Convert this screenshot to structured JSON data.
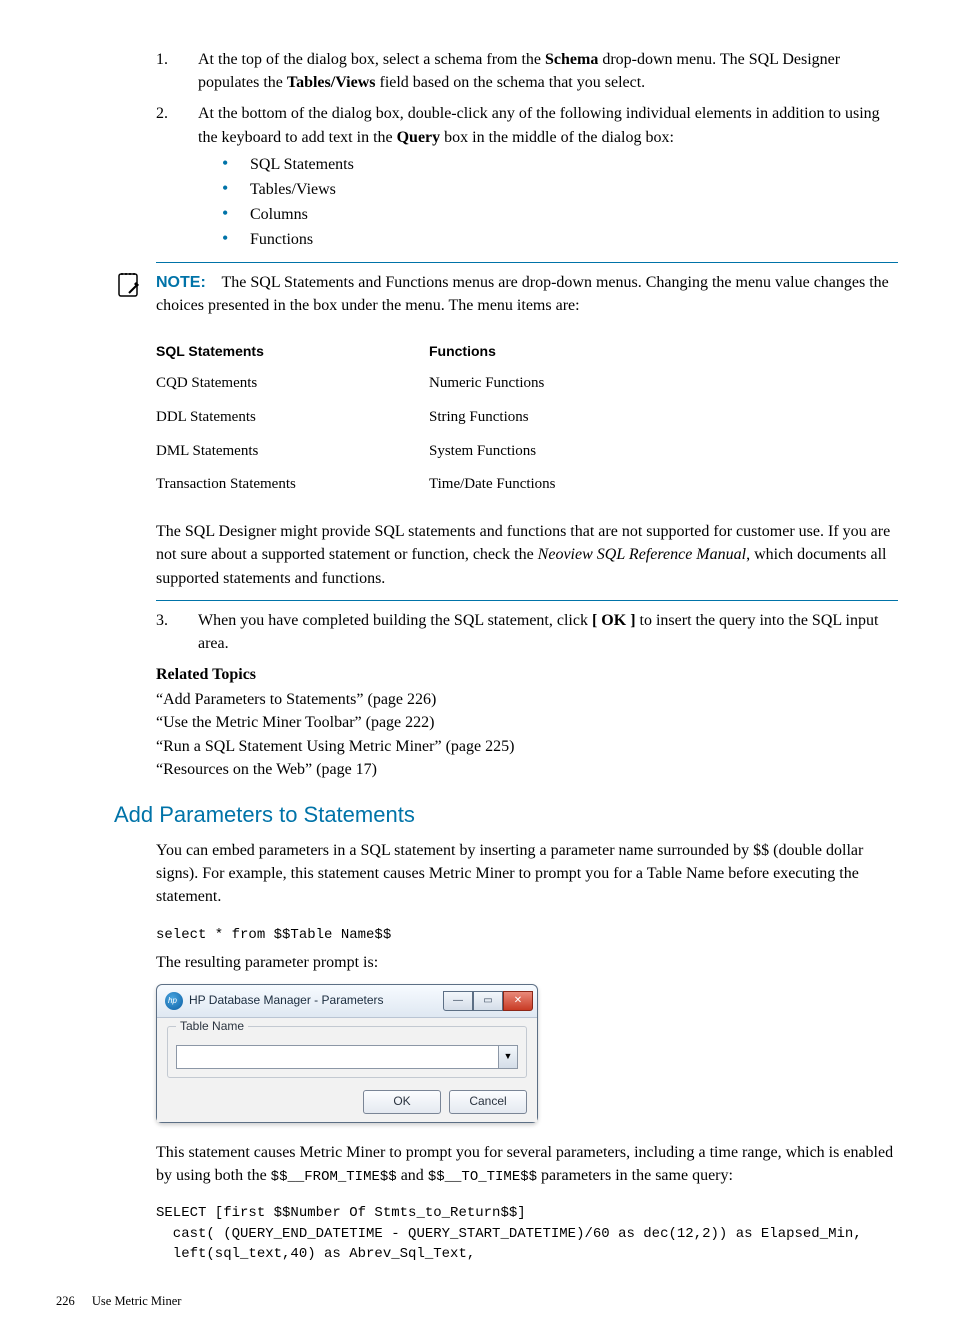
{
  "steps": {
    "s1": {
      "text_a": "At the top of the dialog box, select a schema from the ",
      "schema_bold": "Schema",
      "text_b": " drop-down menu. The SQL Designer populates the ",
      "tv_bold": "Tables/Views",
      "text_c": " field based on the schema that you select."
    },
    "s2": {
      "text_a": "At the bottom of the dialog box, double-click any of the following individual elements in addition to using the keyboard to add text in the ",
      "query_bold": "Query",
      "text_b": " box in the middle of the dialog box:",
      "bullets": [
        "SQL Statements",
        "Tables/Views",
        "Columns",
        "Functions"
      ]
    },
    "s3": {
      "text_a": "When you have completed building the SQL statement, click ",
      "ok_bold": "[ OK ]",
      "text_b": " to insert the query into the SQL input area."
    }
  },
  "note": {
    "label": "NOTE:",
    "body": "The SQL Statements and Functions menus are drop-down menus. Changing the menu value changes the choices presented in the box under the menu. The menu items are:",
    "table": {
      "h1": "SQL Statements",
      "h2": "Functions",
      "rows": [
        [
          "CQD Statements",
          "Numeric Functions"
        ],
        [
          "DDL Statements",
          "String Functions"
        ],
        [
          "DML Statements",
          "System Functions"
        ],
        [
          "Transaction Statements",
          "Time/Date Functions"
        ]
      ]
    },
    "tail_a": "The SQL Designer might provide SQL statements and functions that are not supported for customer use. If you are not sure about a supported statement or function, check the ",
    "tail_italic": "Neoview SQL Reference Manual",
    "tail_b": ", which documents all supported statements and functions."
  },
  "related": {
    "heading": "Related Topics",
    "links": [
      "“Add Parameters to Statements” (page 226)",
      "“Use the Metric Miner Toolbar” (page 222)",
      "“Run a SQL Statement Using Metric Miner” (page 225)",
      "“Resources on the Web” (page 17)"
    ]
  },
  "section2": {
    "title": "Add Parameters to Statements",
    "intro": "You can embed parameters in a SQL statement by inserting a parameter name surrounded by $$ (double dollar signs). For example, this statement causes Metric Miner to prompt you for a Table Name before executing the statement.",
    "code1": "select * from $$Table Name$$",
    "result_line": "The resulting parameter prompt is:",
    "dialog": {
      "title": "HP Database Manager - Parameters",
      "group_label": "Table Name",
      "ok": "OK",
      "cancel": "Cancel"
    },
    "outro_a": "This statement causes Metric Miner to prompt you for several parameters, including a time range, which is enabled by using both the ",
    "outro_code1": "$$__FROM_TIME$$",
    "outro_mid": " and ",
    "outro_code2": "$$__TO_TIME$$",
    "outro_b": " parameters in the same query:",
    "code2": "SELECT [first $$Number Of Stmts_to_Return$$]\n  cast( (QUERY_END_DATETIME - QUERY_START_DATETIME)/60 as dec(12,2)) as Elapsed_Min,\n  left(sql_text,40) as Abrev_Sql_Text,"
  },
  "footer": {
    "page": "226",
    "section": "Use Metric Miner"
  }
}
